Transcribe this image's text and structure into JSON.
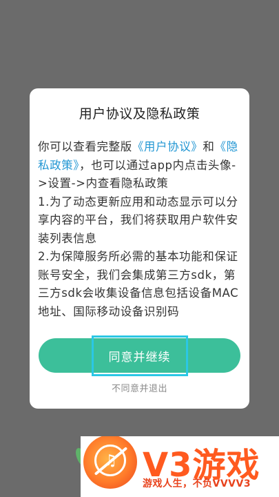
{
  "dialog": {
    "title": "用户协议及隐私政策",
    "content": {
      "p1_prefix": "你可以查看完整版",
      "user_agreement_link": "《用户协议》",
      "p1_and": "和",
      "privacy_link": "《隐私政策》",
      "p1_suffix": "，也可以通过app内点击头像->设置->内查看隐私政策",
      "p2": "1.为了动态更新应用和动态显示可以分享内容的平台，我们将获取用户软件安装列表信息",
      "p3": "2.为保障服务所必需的基本功能和保证账号安全，我们会集成第三方sdk，第三方sdk会收集设备信息包括设备MAC地址、国际移动设备识别码"
    },
    "agree_button": "同意并继续",
    "disagree_link": "不同意并退出"
  },
  "banner": {
    "brand": "V3游戏",
    "slogan": "游戏人生，不负VVVV3"
  },
  "colors": {
    "overlay": "#6b6b6b",
    "accent_green": "#3cbf9a",
    "link_blue": "#2196d3",
    "brand_orange": "#ff5a1f"
  }
}
